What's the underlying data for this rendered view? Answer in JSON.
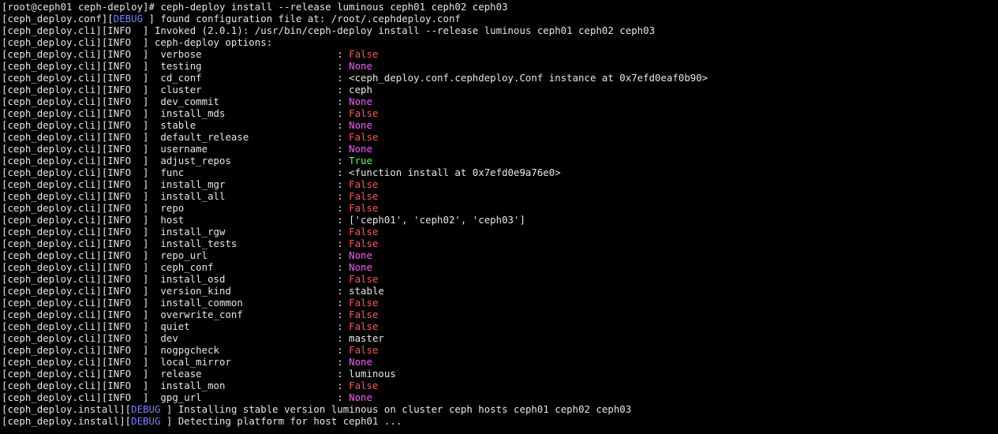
{
  "colors": {
    "background": "#000000",
    "text": "#e6e6e6",
    "debug": "#7f7fff",
    "false": "#ff5555",
    "none": "#ff55ff",
    "true": "#55ff55"
  },
  "lines": [
    {
      "segments": [
        {
          "text": "[root@ceph01 ceph-deploy]# ceph-deploy install --release luminous ceph01 ceph02 ceph03",
          "color": "default"
        }
      ]
    },
    {
      "segments": [
        {
          "text": "[ceph_deploy.conf][",
          "color": "default"
        },
        {
          "text": "DEBUG",
          "color": "debug"
        },
        {
          "text": " ] found configuration file at: /root/.cephdeploy.conf",
          "color": "default"
        }
      ]
    },
    {
      "segments": [
        {
          "text": "[ceph_deploy.cli][INFO  ] Invoked (2.0.1): /usr/bin/ceph-deploy install --release luminous ceph01 ceph02 ceph03",
          "color": "default"
        }
      ]
    },
    {
      "segments": [
        {
          "text": "[ceph_deploy.cli][INFO  ] ceph-deploy options:",
          "color": "default"
        }
      ]
    },
    {
      "segments": [
        {
          "text": "[ceph_deploy.cli][INFO  ]  verbose                       : ",
          "color": "default"
        },
        {
          "text": "False",
          "color": "false"
        }
      ]
    },
    {
      "segments": [
        {
          "text": "[ceph_deploy.cli][INFO  ]  testing                       : ",
          "color": "default"
        },
        {
          "text": "None",
          "color": "none"
        }
      ]
    },
    {
      "segments": [
        {
          "text": "[ceph_deploy.cli][INFO  ]  cd_conf                       : <ceph_deploy.conf.cephdeploy.Conf instance at 0x7efd0eaf0b90>",
          "color": "default"
        }
      ]
    },
    {
      "segments": [
        {
          "text": "[ceph_deploy.cli][INFO  ]  cluster                       : ceph",
          "color": "default"
        }
      ]
    },
    {
      "segments": [
        {
          "text": "[ceph_deploy.cli][INFO  ]  dev_commit                    : ",
          "color": "default"
        },
        {
          "text": "None",
          "color": "none"
        }
      ]
    },
    {
      "segments": [
        {
          "text": "[ceph_deploy.cli][INFO  ]  install_mds                   : ",
          "color": "default"
        },
        {
          "text": "False",
          "color": "false"
        }
      ]
    },
    {
      "segments": [
        {
          "text": "[ceph_deploy.cli][INFO  ]  stable                        : ",
          "color": "default"
        },
        {
          "text": "None",
          "color": "none"
        }
      ]
    },
    {
      "segments": [
        {
          "text": "[ceph_deploy.cli][INFO  ]  default_release               : ",
          "color": "default"
        },
        {
          "text": "False",
          "color": "false"
        }
      ]
    },
    {
      "segments": [
        {
          "text": "[ceph_deploy.cli][INFO  ]  username                      : ",
          "color": "default"
        },
        {
          "text": "None",
          "color": "none"
        }
      ]
    },
    {
      "segments": [
        {
          "text": "[ceph_deploy.cli][INFO  ]  adjust_repos                  : ",
          "color": "default"
        },
        {
          "text": "True",
          "color": "true"
        }
      ]
    },
    {
      "segments": [
        {
          "text": "[ceph_deploy.cli][INFO  ]  func                          : <function install at 0x7efd0e9a76e0>",
          "color": "default"
        }
      ]
    },
    {
      "segments": [
        {
          "text": "[ceph_deploy.cli][INFO  ]  install_mgr                   : ",
          "color": "default"
        },
        {
          "text": "False",
          "color": "false"
        }
      ]
    },
    {
      "segments": [
        {
          "text": "[ceph_deploy.cli][INFO  ]  install_all                   : ",
          "color": "default"
        },
        {
          "text": "False",
          "color": "false"
        }
      ]
    },
    {
      "segments": [
        {
          "text": "[ceph_deploy.cli][INFO  ]  repo                          : ",
          "color": "default"
        },
        {
          "text": "False",
          "color": "false"
        }
      ]
    },
    {
      "segments": [
        {
          "text": "[ceph_deploy.cli][INFO  ]  host                          : ['ceph01', 'ceph02', 'ceph03']",
          "color": "default"
        }
      ]
    },
    {
      "segments": [
        {
          "text": "[ceph_deploy.cli][INFO  ]  install_rgw                   : ",
          "color": "default"
        },
        {
          "text": "False",
          "color": "false"
        }
      ]
    },
    {
      "segments": [
        {
          "text": "[ceph_deploy.cli][INFO  ]  install_tests                 : ",
          "color": "default"
        },
        {
          "text": "False",
          "color": "false"
        }
      ]
    },
    {
      "segments": [
        {
          "text": "[ceph_deploy.cli][INFO  ]  repo_url                      : ",
          "color": "default"
        },
        {
          "text": "None",
          "color": "none"
        }
      ]
    },
    {
      "segments": [
        {
          "text": "[ceph_deploy.cli][INFO  ]  ceph_conf                     : ",
          "color": "default"
        },
        {
          "text": "None",
          "color": "none"
        }
      ]
    },
    {
      "segments": [
        {
          "text": "[ceph_deploy.cli][INFO  ]  install_osd                   : ",
          "color": "default"
        },
        {
          "text": "False",
          "color": "false"
        }
      ]
    },
    {
      "segments": [
        {
          "text": "[ceph_deploy.cli][INFO  ]  version_kind                  : stable",
          "color": "default"
        }
      ]
    },
    {
      "segments": [
        {
          "text": "[ceph_deploy.cli][INFO  ]  install_common                : ",
          "color": "default"
        },
        {
          "text": "False",
          "color": "false"
        }
      ]
    },
    {
      "segments": [
        {
          "text": "[ceph_deploy.cli][INFO  ]  overwrite_conf                : ",
          "color": "default"
        },
        {
          "text": "False",
          "color": "false"
        }
      ]
    },
    {
      "segments": [
        {
          "text": "[ceph_deploy.cli][INFO  ]  quiet                         : ",
          "color": "default"
        },
        {
          "text": "False",
          "color": "false"
        }
      ]
    },
    {
      "segments": [
        {
          "text": "[ceph_deploy.cli][INFO  ]  dev                           : master",
          "color": "default"
        }
      ]
    },
    {
      "segments": [
        {
          "text": "[ceph_deploy.cli][INFO  ]  nogpgcheck                    : ",
          "color": "default"
        },
        {
          "text": "False",
          "color": "false"
        }
      ]
    },
    {
      "segments": [
        {
          "text": "[ceph_deploy.cli][INFO  ]  local_mirror                  : ",
          "color": "default"
        },
        {
          "text": "None",
          "color": "none"
        }
      ]
    },
    {
      "segments": [
        {
          "text": "[ceph_deploy.cli][INFO  ]  release                       : luminous",
          "color": "default"
        }
      ]
    },
    {
      "segments": [
        {
          "text": "[ceph_deploy.cli][INFO  ]  install_mon                   : ",
          "color": "default"
        },
        {
          "text": "False",
          "color": "false"
        }
      ]
    },
    {
      "segments": [
        {
          "text": "[ceph_deploy.cli][INFO  ]  gpg_url                       : ",
          "color": "default"
        },
        {
          "text": "None",
          "color": "none"
        }
      ]
    },
    {
      "segments": [
        {
          "text": "[ceph_deploy.install][",
          "color": "default"
        },
        {
          "text": "DEBUG",
          "color": "debug"
        },
        {
          "text": " ] Installing stable version luminous on cluster ceph hosts ceph01 ceph02 ceph03",
          "color": "default"
        }
      ]
    },
    {
      "segments": [
        {
          "text": "[ceph_deploy.install][",
          "color": "default"
        },
        {
          "text": "DEBUG",
          "color": "debug"
        },
        {
          "text": " ] Detecting platform for host ceph01 ...",
          "color": "default"
        }
      ]
    }
  ]
}
